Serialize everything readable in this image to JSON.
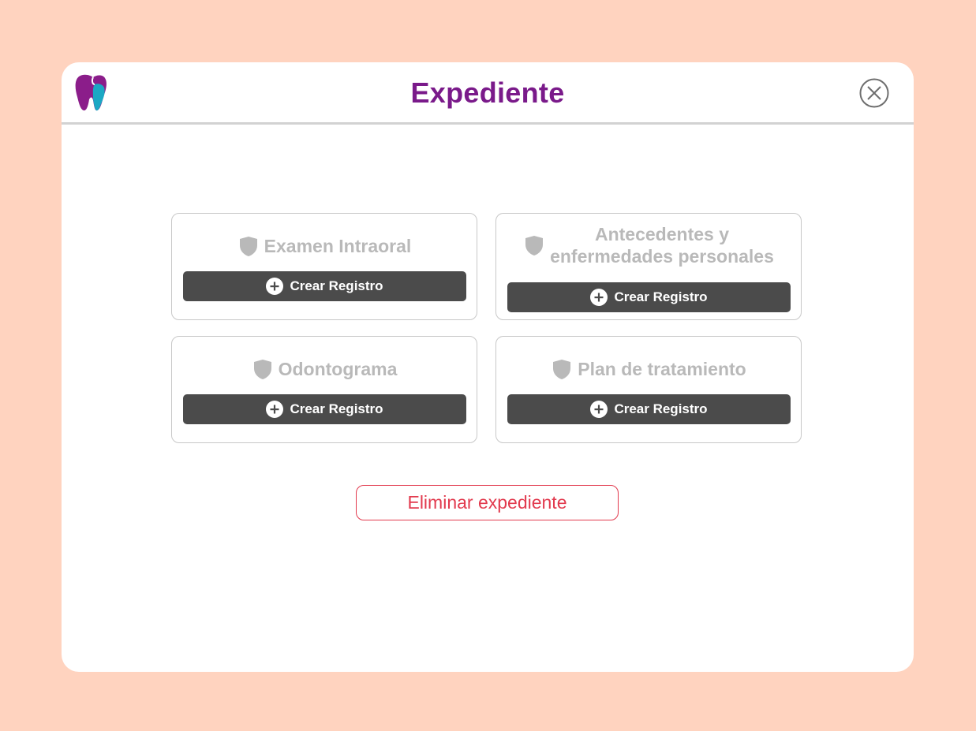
{
  "modal": {
    "title": "Expediente",
    "logo_icon": "tooth-logo-icon",
    "close_icon": "close-icon",
    "colors": {
      "background": "#FFD3BF",
      "title": "#7A1A8A",
      "card_title": "#B9B9B9",
      "button": "#4B4B4B",
      "danger": "#E23A4E"
    }
  },
  "sections": [
    {
      "title": "Examen Intraoral",
      "icon": "shield-icon",
      "button_label": "Crear Registro",
      "button_icon": "plus-circle-icon"
    },
    {
      "title_line1": "Antecedentes y",
      "title_line2": "enfermedades personales",
      "icon": "shield-icon",
      "button_label": "Crear Registro",
      "button_icon": "plus-circle-icon"
    },
    {
      "title": "Odontograma",
      "icon": "shield-icon",
      "button_label": "Crear Registro",
      "button_icon": "plus-circle-icon"
    },
    {
      "title": "Plan de tratamiento",
      "icon": "shield-icon",
      "button_label": "Crear Registro",
      "button_icon": "plus-circle-icon"
    }
  ],
  "delete_button": {
    "label": "Eliminar expediente"
  }
}
